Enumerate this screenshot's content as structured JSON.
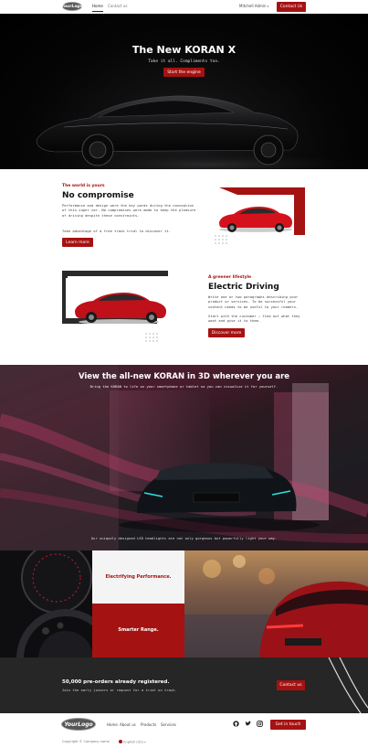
{
  "nav": {
    "logo": "YourLogo",
    "home": "Home",
    "contact": "Contact us",
    "user": "Mitchell Admin",
    "cta": "Contact Us"
  },
  "hero": {
    "title": "The New KORAN X",
    "subtitle": "Take it all. Compliments too.",
    "button": "Start the engine"
  },
  "feature1": {
    "kicker": "The world is yours",
    "title": "No compromise",
    "paragraph1": "Performance and design were the key words during the conception of this super car. No compromises were made to keep the pleasure of driving despite these constraints.",
    "paragraph2": "Take advantage of a free track trial to discover it.",
    "button": "Learn more"
  },
  "feature2": {
    "kicker": "A greener lifestyle",
    "title": "Electric Driving",
    "paragraph1": "Write one or two paragraphs describing your product or services. To be successful your content needs to be useful to your readers.",
    "paragraph2": "Start with the customer – find out what they want and give it to them.",
    "button": "Discover more"
  },
  "section3d": {
    "title": "View the all-new KORAN in 3D wherever you are",
    "subtitle": "Bring the KORAN to life on your smartphone or tablet so you can visualize it for yourself.",
    "footnote": "Our uniquely designed LED headlights are not only gorgeous but powerfully light your way."
  },
  "tiles": {
    "performance": "Electrifying Performance.",
    "range": "Smarter Range."
  },
  "preorder": {
    "title": "50,000 pre-orders already registered.",
    "subtitle": "Join the early joiners or request for a trial on track.",
    "button": "Contact us"
  },
  "footer": {
    "logo": "YourLogo",
    "links": [
      "Home",
      "About us",
      "Products",
      "Services"
    ],
    "social_icons": [
      "github-icon",
      "twitter-icon",
      "instagram-icon"
    ],
    "cta": "Get in touch",
    "copyright": "Copyright © Company name",
    "language": "English (US)"
  },
  "colors": {
    "accent": "#a51212",
    "dark": "#262626",
    "hero_bg": "#000000"
  }
}
